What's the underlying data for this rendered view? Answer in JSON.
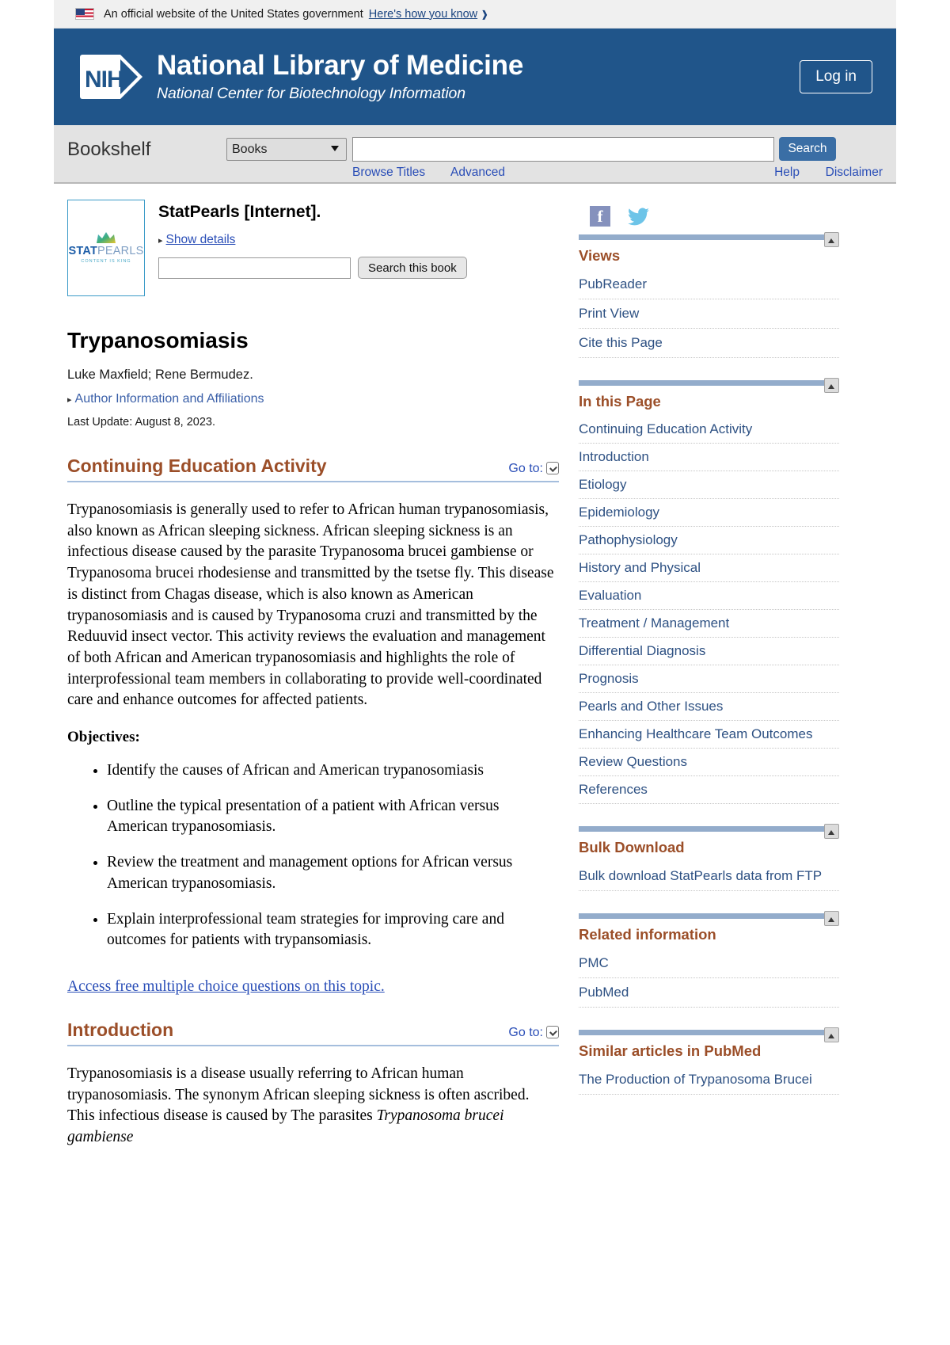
{
  "gov_banner": {
    "text": "An official website of the United States government",
    "link": "Here's how you know",
    "flag_icon": "us-flag-icon",
    "chevron_icon": "chevron-down-icon"
  },
  "header": {
    "logo_text": "NIH",
    "title": "National Library of Medicine",
    "subtitle": "National Center for Biotechnology Information",
    "login_label": "Log in",
    "bg_color": "#20558a"
  },
  "searchbar": {
    "site_name": "Bookshelf",
    "database": "Books",
    "database_options": [
      "Books"
    ],
    "query": "",
    "placeholder": "",
    "search_label": "Search",
    "links": {
      "browse": "Browse Titles",
      "advanced": "Advanced",
      "help": "Help",
      "disclaimer": "Disclaimer"
    }
  },
  "book": {
    "cover_logo_word_bold": "STAT",
    "cover_logo_word_light": "PEARLS",
    "cover_tagline": "CONTENT IS KING",
    "title": "StatPearls [Internet].",
    "show_details": "Show details",
    "search_value": "",
    "search_placeholder": "",
    "search_button": "Search this book"
  },
  "article": {
    "title": "Trypanosomiasis",
    "authors": "Luke Maxfield; Rene Bermudez.",
    "author_info_link": "Author Information and Affiliations",
    "last_update": "Last Update: August 8, 2023.",
    "goto_label": "Go to:",
    "sections": [
      {
        "heading": "Continuing Education Activity",
        "paragraph": "Trypanosomiasis is generally used to refer to African human trypanosomiasis, also known as African sleeping sickness. African sleeping sickness is an infectious disease caused by the parasite Trypanosoma brucei gambiense or Trypanosoma brucei rhodesiense and transmitted by the tsetse fly. This disease is distinct from Chagas disease, which is also known as American trypanosomiasis and is caused by Trypanosoma cruzi and transmitted by the Reduuvid insect vector. This activity reviews the evaluation and management of both African and American trypanosomiasis and highlights the role of interprofessional team members in collaborating to provide well-coordinated care and enhance outcomes for affected patients.",
        "objectives_label": "Objectives:",
        "objectives": [
          "Identify the causes of African and American trypanosomiasis",
          "Outline the typical presentation of a patient with African versus American trypanosomiasis.",
          "Review the treatment and management options for African versus American trypanosomiasis.",
          "Explain interprofessional team strategies for improving care and outcomes for patients with trypansomiasis."
        ],
        "mcq_link": "Access free multiple choice questions on this topic."
      },
      {
        "heading": "Introduction",
        "paragraph_start": "Trypanosomiasis is a disease usually referring to African human trypanosomiasis. The synonym African sleeping sickness is often ascribed. This infectious disease is caused by The parasites ",
        "paragraph_italic": "Trypanosoma brucei gambiense"
      }
    ]
  },
  "sidebar": {
    "social": {
      "facebook": "facebook-icon",
      "twitter": "twitter-icon"
    },
    "blocks": [
      {
        "title": "Views",
        "collapse_icon": "collapse-icon",
        "items": [
          "PubReader",
          "Print View",
          "Cite this Page"
        ]
      },
      {
        "title": "In this Page",
        "collapse_icon": "collapse-icon",
        "items": [
          "Continuing Education Activity",
          "Introduction",
          "Etiology",
          "Epidemiology",
          "Pathophysiology",
          "History and Physical",
          "Evaluation",
          "Treatment / Management",
          "Differential Diagnosis",
          "Prognosis",
          "Pearls and Other Issues",
          "Enhancing Healthcare Team Outcomes",
          "Review Questions",
          "References"
        ]
      },
      {
        "title": "Bulk Download",
        "collapse_icon": "collapse-icon",
        "items": [
          "Bulk download StatPearls data from FTP"
        ]
      },
      {
        "title": "Related information",
        "collapse_icon": "collapse-icon",
        "items": [
          "PMC",
          "PubMed"
        ]
      },
      {
        "title": "Similar articles in PubMed",
        "collapse_icon": "collapse-icon",
        "items": [
          "The Production of Trypanosoma Brucei"
        ]
      }
    ]
  },
  "colors": {
    "nih_blue": "#20558a",
    "heading_brown": "#9b4e28",
    "link_blue": "#2e5183",
    "rule_blue": "#93accb"
  }
}
